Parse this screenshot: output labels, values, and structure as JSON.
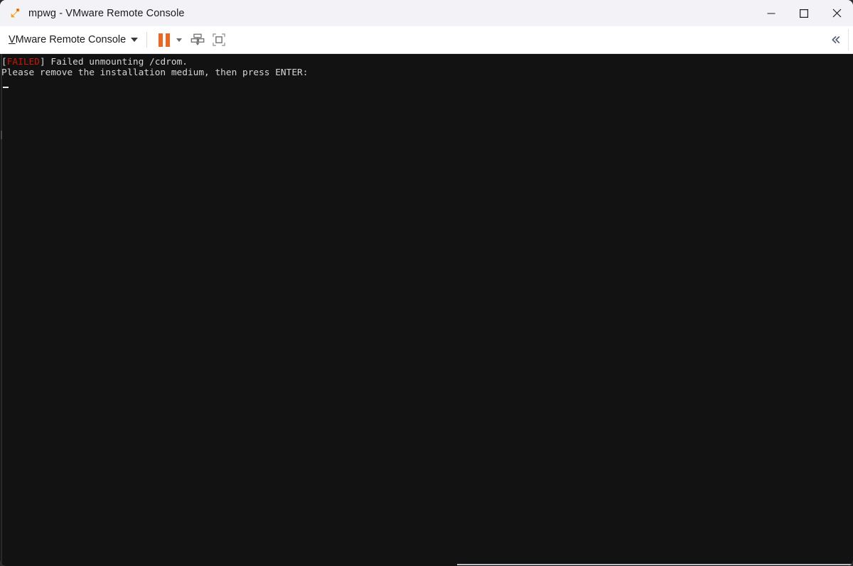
{
  "window": {
    "title": "mpwg - VMware Remote Console",
    "app_icon": "vmware-vmrc-icon",
    "controls": {
      "minimize": "minimize-icon",
      "maximize": "maximize-icon",
      "close": "close-icon"
    }
  },
  "toolbar": {
    "menu_label_prefix": "V",
    "menu_label_rest": "Mware Remote Console",
    "menu_label_full": "VMware Remote Console",
    "buttons": [
      {
        "name": "pause-button",
        "icon": "pause-icon",
        "label": "Pause"
      },
      {
        "name": "power-dropdown",
        "icon": "chevron-down-icon",
        "label": "Power options"
      },
      {
        "name": "removable-devices-button",
        "icon": "removable-devices-icon",
        "label": "Manage removable devices"
      },
      {
        "name": "fullscreen-button",
        "icon": "fullscreen-icon",
        "label": "Enter full screen"
      }
    ],
    "collapse": {
      "name": "collapse-toolbar-button",
      "icon": "double-chevron-left-icon",
      "label": "Collapse toolbar"
    }
  },
  "console": {
    "background": "#121212",
    "foreground": "#d6d6d6",
    "failed_color": "#d21404",
    "lines": [
      {
        "segments": [
          {
            "text": "[",
            "color": "fg"
          },
          {
            "text": "FAILED",
            "color": "failed"
          },
          {
            "text": "] Failed unmounting /cdrom.",
            "color": "fg"
          }
        ]
      },
      {
        "segments": [
          {
            "text": "Please remove the installation medium, then press ENTER:",
            "color": "fg"
          }
        ]
      }
    ],
    "line1_bracket_open": "[",
    "line1_status": "FAILED",
    "line1_rest": "] Failed unmounting /cdrom.",
    "line2": "Please remove the installation medium, then press ENTER:",
    "cursor": "_"
  },
  "scrollbar": {
    "horizontal": {
      "name": "horizontal-scrollbar",
      "visible": true
    },
    "vertical_edge": {
      "name": "console-left-edge",
      "visible": true
    }
  }
}
